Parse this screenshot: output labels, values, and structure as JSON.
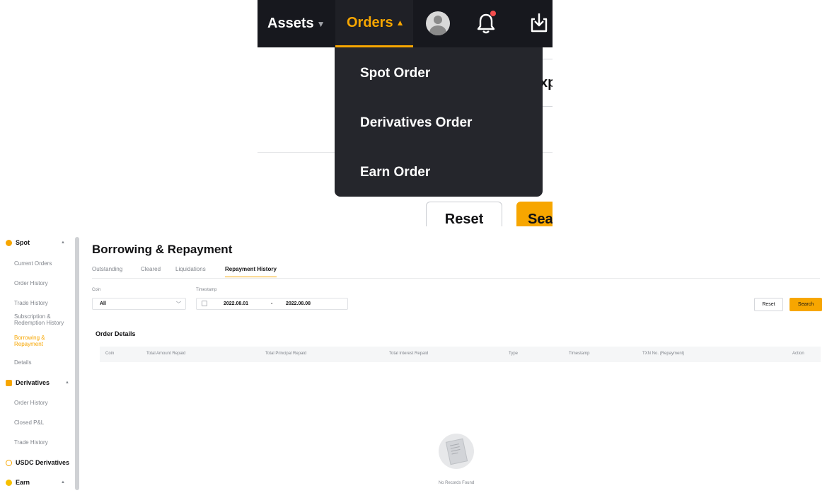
{
  "zoom": {
    "nav": {
      "assets_label": "Assets",
      "orders_label": "Orders"
    },
    "dropdown_items": [
      "Spot Order",
      "Derivatives Order",
      "Earn Order"
    ],
    "partial_input_text": "xp",
    "reset_label": "Reset",
    "search_partial_label": "Sea"
  },
  "sidebar": {
    "groups": [
      {
        "label": "Spot",
        "icon": "spot-icon",
        "items": [
          "Current Orders",
          "Order History",
          "Trade History",
          "Subscription & Redemption History",
          "Borrowing & Repayment",
          "Details"
        ]
      },
      {
        "label": "Derivatives",
        "icon": "derivatives-icon",
        "items": [
          "Order History",
          "Closed P&L",
          "Trade History"
        ]
      },
      {
        "label": "USDC Derivatives",
        "icon": "usdc-icon",
        "items": []
      },
      {
        "label": "Earn",
        "icon": "earn-icon",
        "items": []
      }
    ],
    "active_item": "Borrowing & Repayment"
  },
  "main": {
    "title": "Borrowing & Repayment",
    "tabs": [
      "Outstanding",
      "Cleared",
      "Liquidations",
      "Repayment History"
    ],
    "active_tab": "Repayment History",
    "filters": {
      "coin_label": "Coin",
      "coin_value": "All",
      "timestamp_label": "Timestamp",
      "date_from": "2022.08.01",
      "date_sep": "-",
      "date_to": "2022.08.08"
    },
    "reset_label": "Reset",
    "search_label": "Search",
    "panel_title": "Order Details",
    "columns": [
      "Coin",
      "Total Amount Repaid",
      "Total Principal Repaid",
      "Total Interest Repaid",
      "Type",
      "Timestamp",
      "TXN No. (Repayment)",
      "Action"
    ],
    "empty_text": "No Records Found"
  },
  "colors": {
    "accent": "#f7a600",
    "nav_bg": "#17181e",
    "dropdown_bg": "#25262c",
    "muted_text": "#81858c"
  }
}
